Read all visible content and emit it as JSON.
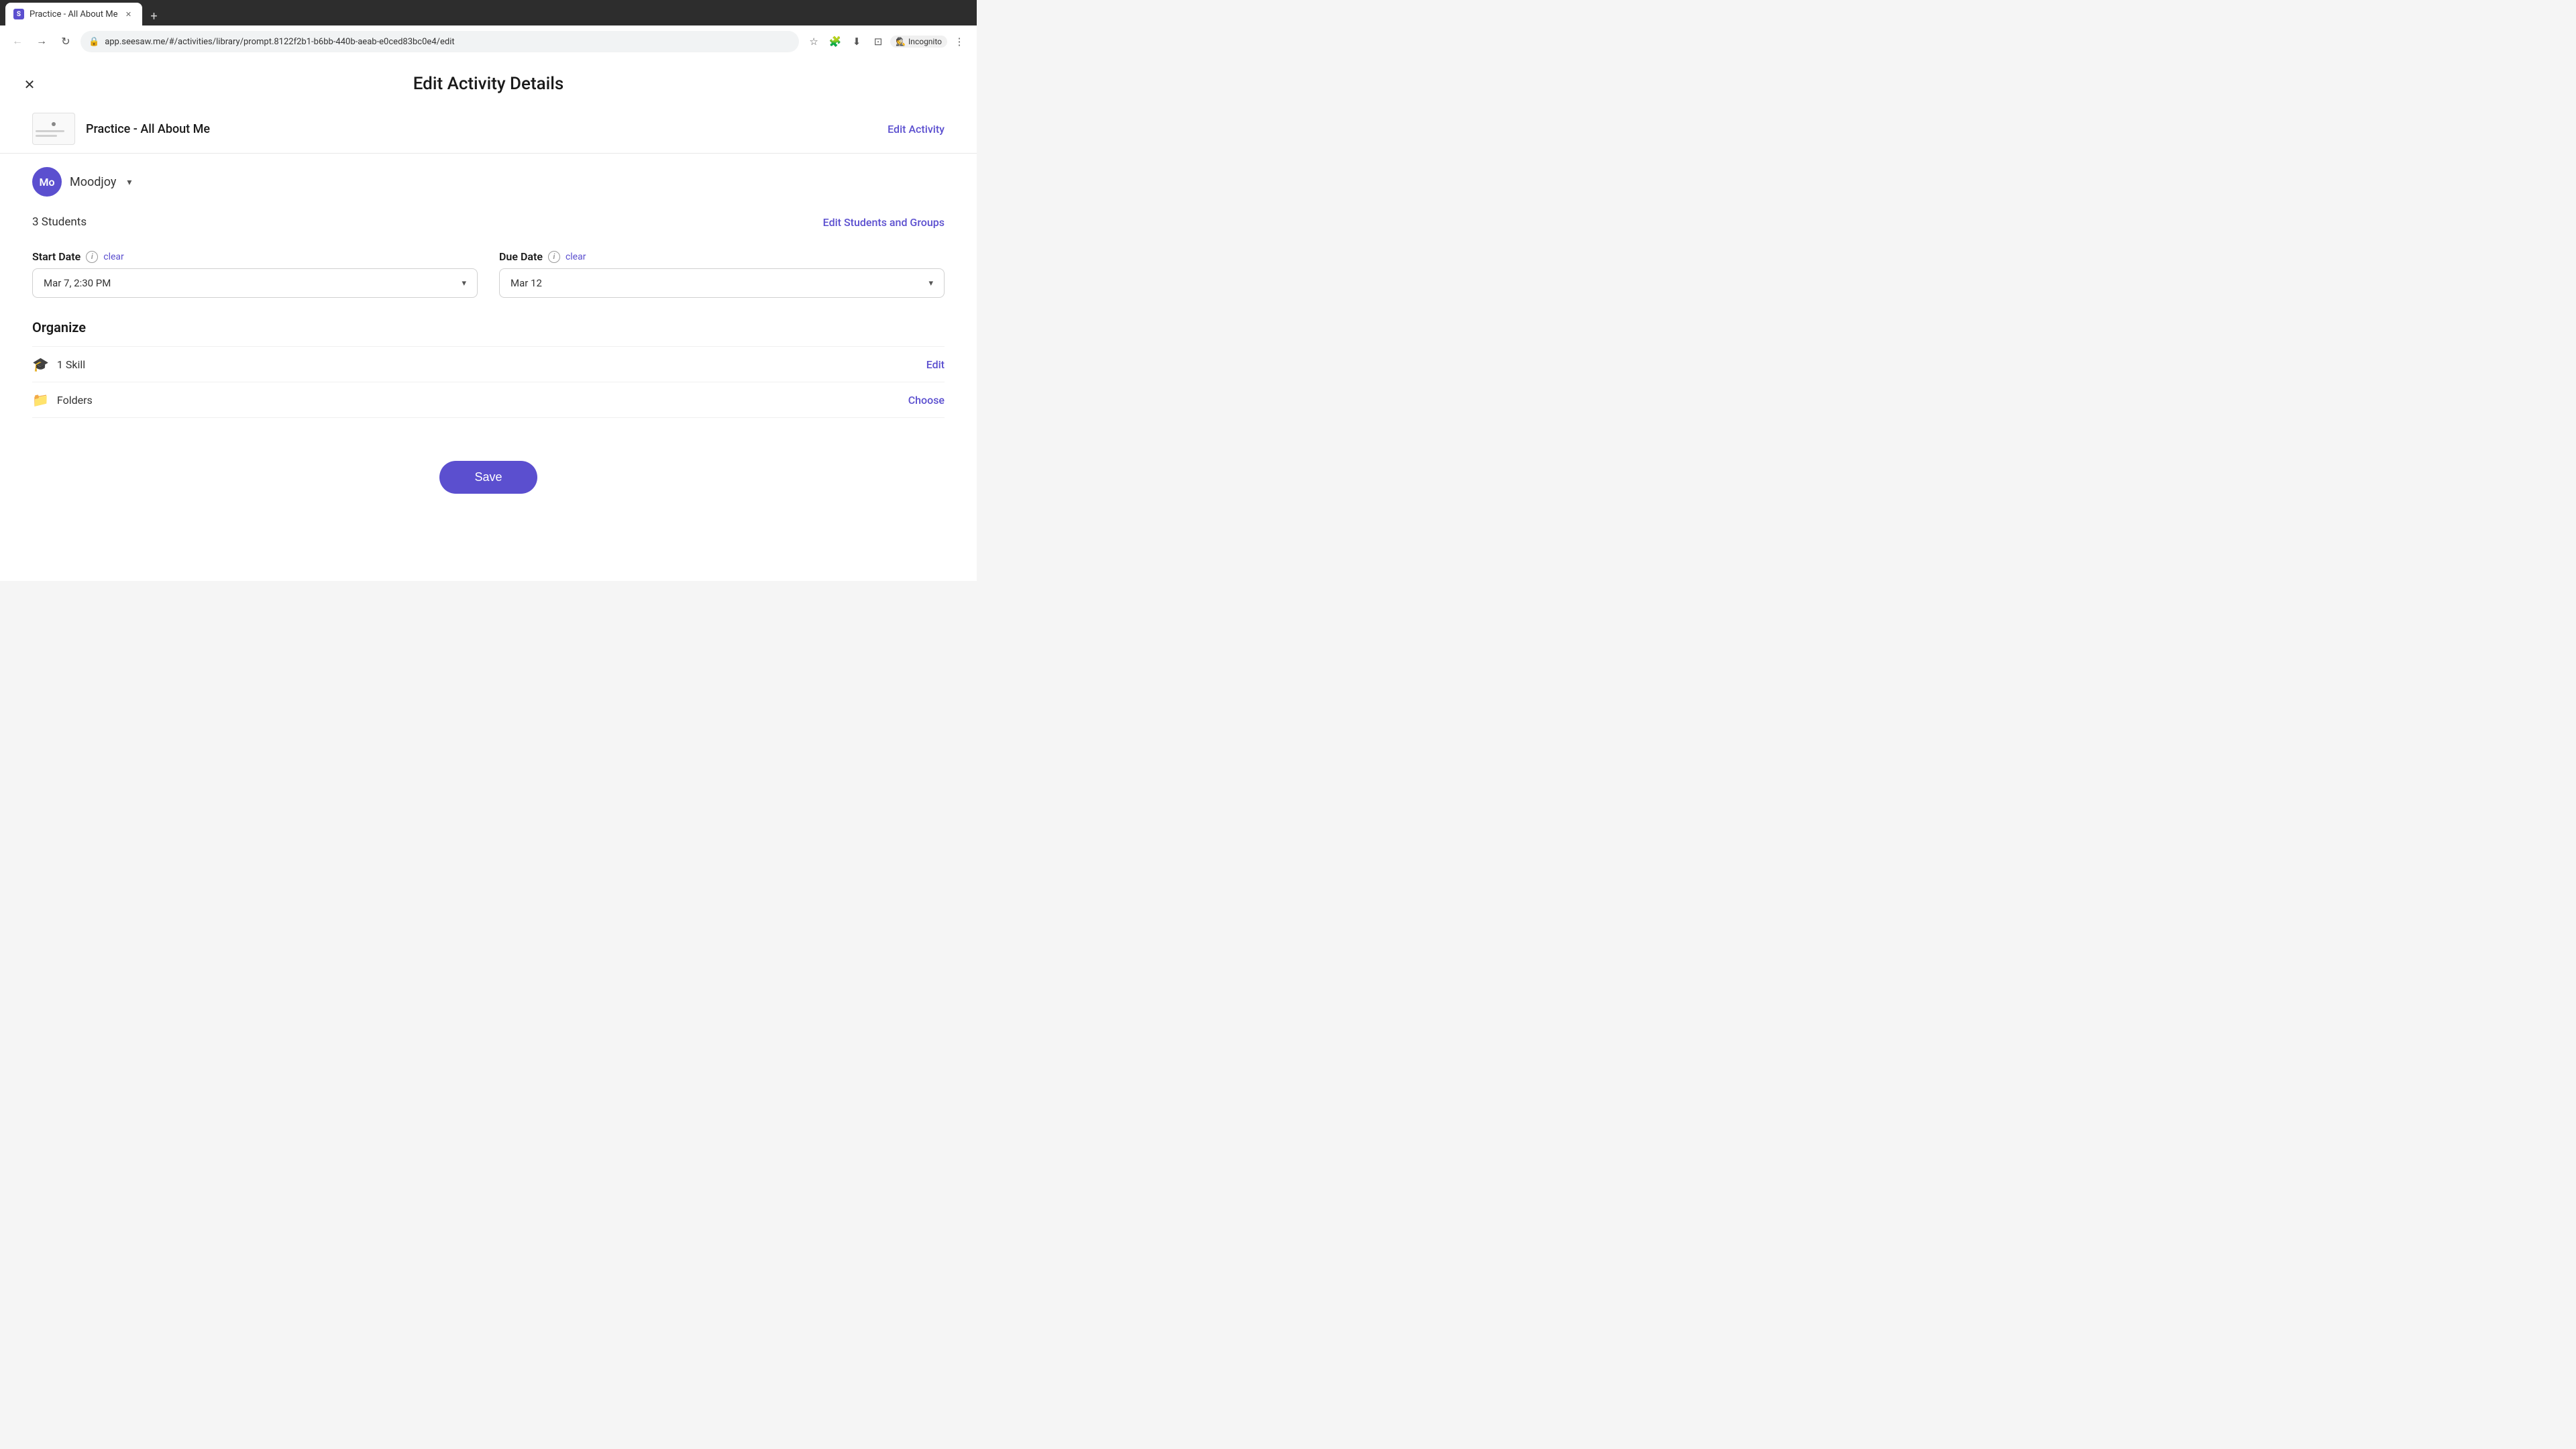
{
  "browser": {
    "tab_title": "Practice - All About Me",
    "favicon_letter": "S",
    "url": "app.seesaw.me/#/activities/library/prompt.8122f2b1-b6bb-440b-aeab-e0ced83bc0e4/edit",
    "incognito_label": "Incognito"
  },
  "page": {
    "title": "Edit Activity Details",
    "close_btn_label": "×"
  },
  "activity": {
    "name": "Practice - All About Me",
    "edit_link_label": "Edit Activity"
  },
  "class": {
    "avatar_initials": "Mo",
    "name": "Moodjoy"
  },
  "students": {
    "count_label": "3 Students",
    "edit_link_label": "Edit Students and Groups"
  },
  "start_date": {
    "label": "Start Date",
    "clear_label": "clear",
    "value": "Mar 7, 2:30 PM"
  },
  "due_date": {
    "label": "Due Date",
    "clear_label": "clear",
    "value": "Mar 12"
  },
  "organize": {
    "title": "Organize",
    "skill_label": "1 Skill",
    "skill_edit_label": "Edit",
    "folders_label": "Folders",
    "folders_choose_label": "Choose"
  },
  "save_btn_label": "Save"
}
